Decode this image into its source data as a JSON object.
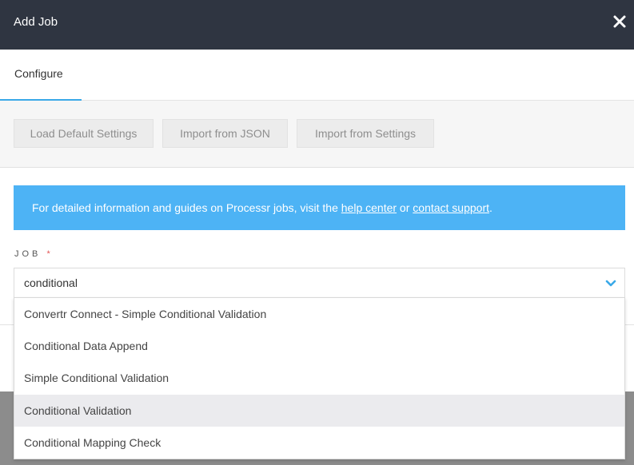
{
  "modal": {
    "title": "Add Job",
    "close_icon": "close-icon"
  },
  "tabs": [
    {
      "label": "Configure",
      "active": true
    }
  ],
  "toolbar": {
    "load_default_label": "Load Default Settings",
    "import_json_label": "Import from JSON",
    "import_settings_label": "Import from Settings"
  },
  "info_banner": {
    "prefix": "For detailed information and guides on Processr jobs, visit the ",
    "help_link": "help center",
    "middle": " or ",
    "support_link": "contact support",
    "suffix": "."
  },
  "job_field": {
    "label": "JOB",
    "required_marker": "*",
    "value": "conditional",
    "dropdown_icon": "chevron-down-icon"
  },
  "dropdown": {
    "options": [
      "Convertr Connect - Simple Conditional Validation",
      "Conditional Data Append",
      "Simple Conditional Validation",
      "Conditional Validation",
      "Conditional Mapping Check"
    ],
    "hovered_index": 3
  },
  "colors": {
    "header_bg": "#2f3541",
    "accent": "#3aa9e8",
    "banner_bg": "#4db3f5",
    "required": "#e35555"
  }
}
